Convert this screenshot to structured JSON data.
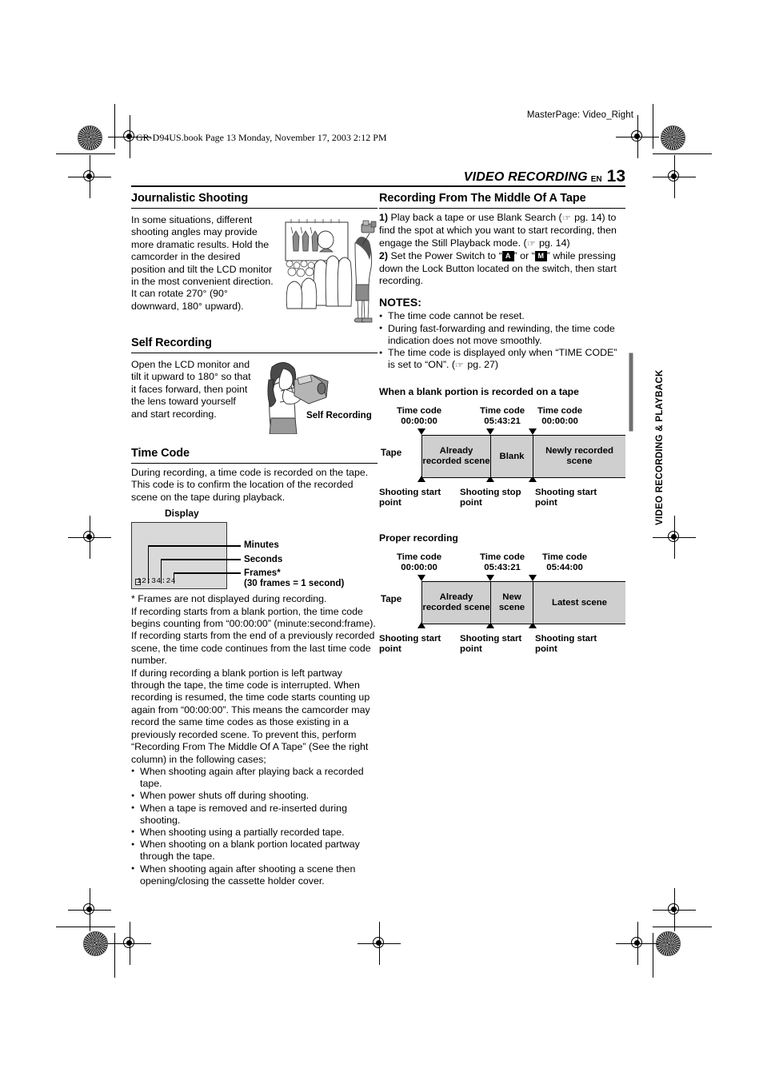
{
  "page": {
    "masterpage": "MasterPage: Video_Right",
    "filestamp": "GR-D94US.book  Page 13  Monday, November 17, 2003  2:12 PM",
    "running_head": "VIDEO RECORDING",
    "lang_code": "EN",
    "page_number": "13",
    "side_tab": "VIDEO RECORDING & PLAYBACK"
  },
  "left_column": {
    "journalistic": {
      "heading": "Journalistic Shooting",
      "body": "In some situations, different shooting angles may provide more dramatic results. Hold the camcorder in the desired position and tilt the LCD monitor in the most convenient direction. It can rotate 270° (90° downward, 180° upward).",
      "illustration_name": "crowd-parade-illustration"
    },
    "self_recording": {
      "heading": "Self Recording",
      "body": "Open the LCD monitor and tilt it upward to 180° so that it faces forward, then point the lens toward yourself and start recording.",
      "illustration_caption": "Self Recording",
      "illustration_name": "self-recording-illustration"
    },
    "time_code": {
      "heading": "Time Code",
      "intro": "During recording, a time code is recorded on the tape. This code is to confirm the location of the recorded scene on the tape during playback.",
      "display_caption": "Display",
      "display_value": "12:34:24",
      "callouts": [
        {
          "label": "Minutes"
        },
        {
          "label": "Seconds"
        },
        {
          "label": "Frames*",
          "sub": "(30 frames = 1 second)"
        }
      ],
      "footnote": "*   Frames are not displayed during recording.",
      "para1": "If recording starts from a blank portion, the time code begins counting from “00:00:00” (minute:second:frame). If recording starts from the end of a previously recorded scene, the time code continues from the last time code number.",
      "para2": "If during recording a blank portion is left partway through the tape, the time code is interrupted. When recording is resumed, the time code starts counting up again from “00:00:00”. This means the camcorder may record the same time codes as those existing in a previously recorded scene. To prevent this, perform “Recording From The Middle Of A Tape” (See the right column) in the following cases;",
      "cases": [
        "When shooting again after playing back a recorded tape.",
        "When power shuts off during shooting.",
        "When a tape is removed and re-inserted during shooting.",
        "When shooting using a partially recorded tape.",
        "When shooting on a blank portion located partway through the tape.",
        "When shooting again after shooting a scene then opening/closing the cassette holder cover."
      ]
    }
  },
  "right_column": {
    "recording_middle": {
      "heading": "Recording From The Middle Of A Tape",
      "step1_num": "1)",
      "step1_a": " Play back a tape or use Blank Search (",
      "step1_b": " pg. 14) to find the spot at which you want to start recording, then engage the Still Playback mode. (",
      "step1_c": " pg. 14)",
      "step2_num": "2)",
      "step2_a": " Set the Power Switch to “",
      "mode_auto": "A",
      "step2_b": "” or “",
      "mode_manual": "M",
      "step2_c": "” while pressing down the Lock Button located on the switch, then start recording.",
      "notes_heading": "NOTES:",
      "notes": [
        "The time code cannot be reset.",
        "During fast-forwarding and rewinding, the time code indication does not move smoothly."
      ],
      "note3_a": "The time code is displayed only when “TIME CODE” is set to “ON”. (",
      "note3_b": " pg. 27)"
    },
    "figure_blank": {
      "title": "When a blank portion is recorded on a tape",
      "tape_label": "Tape",
      "timecodes": [
        {
          "line1": "Time code",
          "line2": "00:00:00"
        },
        {
          "line1": "Time code",
          "line2": "05:43:21"
        },
        {
          "line1": "Time code",
          "line2": "00:00:00"
        }
      ],
      "segments": [
        {
          "text": "Already recorded scene"
        },
        {
          "text": "Blank"
        },
        {
          "text": "Newly recorded scene"
        }
      ],
      "bottom_labels": [
        {
          "line1": "Shooting start",
          "line2": "point"
        },
        {
          "line1": "Shooting stop",
          "line2": "point"
        },
        {
          "line1": "Shooting start",
          "line2": "point"
        }
      ]
    },
    "figure_proper": {
      "title": "Proper recording",
      "tape_label": "Tape",
      "timecodes": [
        {
          "line1": "Time code",
          "line2": "00:00:00"
        },
        {
          "line1": "Time code",
          "line2": "05:43:21"
        },
        {
          "line1": "Time code",
          "line2": "05:44:00"
        }
      ],
      "segments": [
        {
          "text": "Already recorded scene"
        },
        {
          "text": "New scene"
        },
        {
          "text": "Latest scene"
        }
      ],
      "bottom_labels": [
        {
          "line1": "Shooting start",
          "line2": "point"
        },
        {
          "line1": "Shooting start",
          "line2": "point"
        },
        {
          "line1": "Shooting start",
          "line2": "point"
        }
      ]
    }
  }
}
